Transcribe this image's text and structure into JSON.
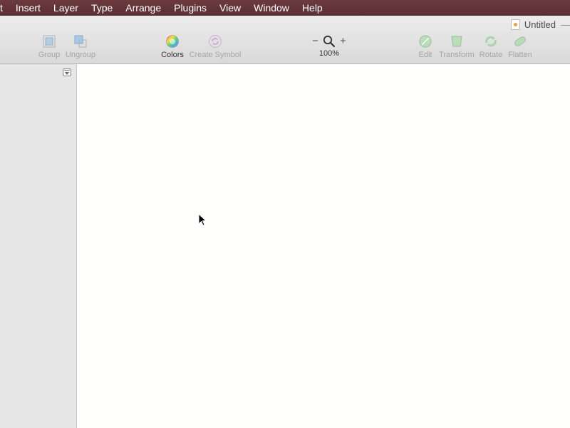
{
  "menubar": {
    "items": [
      "t",
      "Insert",
      "Layer",
      "Type",
      "Arrange",
      "Plugins",
      "View",
      "Window",
      "Help"
    ]
  },
  "document": {
    "title": "Untitled"
  },
  "toolbar": {
    "group_label": "Group",
    "ungroup_label": "Ungroup",
    "colors_label": "Colors",
    "create_symbol_label": "Create Symbol",
    "zoom_out_label": "−",
    "zoom_in_label": "+",
    "zoom_level": "100%",
    "edit_label": "Edit",
    "transform_label": "Transform",
    "rotate_label": "Rotate",
    "flatten_label": "Flatten"
  },
  "colors": {
    "menubar": "#5e3237",
    "chrome": "#e3e3e3",
    "sidebar": "#e7e7e8",
    "canvas": "#fffffe"
  }
}
